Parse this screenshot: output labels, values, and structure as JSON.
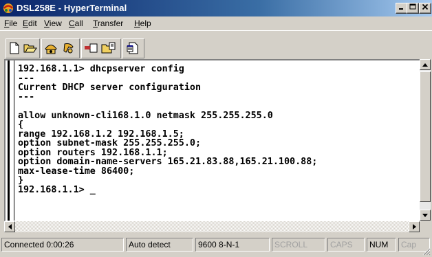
{
  "window": {
    "title": "DSL258E - HyperTerminal"
  },
  "menu": [
    "File",
    "Edit",
    "View",
    "Call",
    "Transfer",
    "Help"
  ],
  "menu_underline": [
    "F",
    "E",
    "V",
    "C",
    "T",
    "H"
  ],
  "toolbar": {
    "icons": [
      "new-icon",
      "open-icon",
      "call-icon",
      "disconnect-icon",
      "send-icon",
      "receive-icon",
      "properties-icon"
    ]
  },
  "terminal": {
    "lines": [
      "192.168.1.1> dhcpserver config",
      "---",
      "Current DHCP server configuration",
      "---",
      "",
      "allow unknown-cli168.1.0 netmask 255.255.255.0",
      "{",
      "range 192.168.1.2 192.168.1.5;",
      "option subnet-mask 255.255.255.0;",
      "option routers 192.168.1.1;",
      "option domain-name-servers 165.21.83.88,165.21.100.88;",
      "max-lease-time 86400;",
      "}",
      "192.168.1.1> _"
    ]
  },
  "status": {
    "connected": "Connected 0:00:26",
    "detect": "Auto detect",
    "settings": "9600 8-N-1",
    "scroll": "SCROLL",
    "caps": "CAPS",
    "num": "NUM",
    "capture": "Cap"
  },
  "colors": {
    "titlebar_start": "#0a246a",
    "titlebar_end": "#a6caf0",
    "face": "#d4d0c8"
  }
}
